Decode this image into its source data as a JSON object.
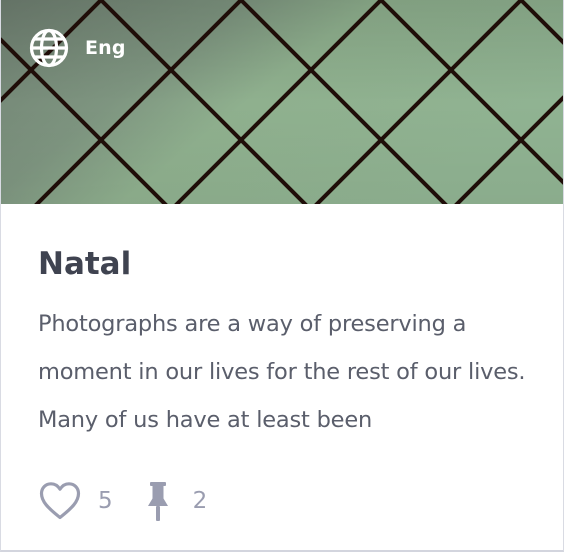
{
  "card": {
    "language": {
      "icon": "globe-icon",
      "label": "Eng"
    },
    "title": "Natal",
    "description": "Photographs are a way of preserving a moment in our lives for the rest of our lives. Many of us have at least been",
    "stats": {
      "likes": {
        "icon": "heart-icon",
        "count": "5"
      },
      "pins": {
        "icon": "pushpin-icon",
        "count": "2"
      }
    }
  },
  "colors": {
    "hero_green": "#8fb08e",
    "hero_dark_green": "#6e8270",
    "lattice_bar": "#1f0d08",
    "title_text": "#3f4350",
    "body_text": "#5a5e6b",
    "muted_icon": "#9a9db0"
  }
}
